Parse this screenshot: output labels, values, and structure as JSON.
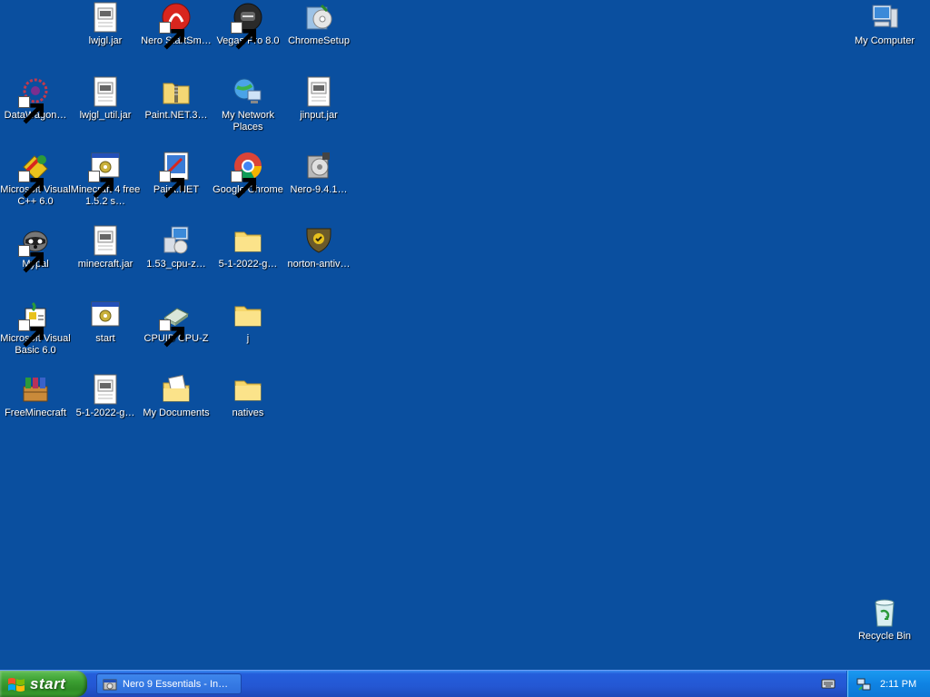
{
  "desktop": {
    "background": "#0a4f9f",
    "icons": {
      "lwjgl_jar": "lwjgl.jar",
      "nero_startsmart": "Nero StartSm…",
      "vegas_pro": "Vegas Pro 8.0",
      "chromesetup": "ChromeSetup",
      "my_computer": "My Computer",
      "datawagon": "DataWagon…",
      "lwjgl_util_jar": "lwjgl_util.jar",
      "paint_net_zip": "Paint.NET.3…",
      "my_network_places": "My Network Places",
      "jinput_jar": "jinput.jar",
      "ms_visual_cpp": "Microsoft Visual C++ 6.0",
      "minecraft4free": "Minecraft 4 free 1.5.2 s…",
      "paint_net": "Paint.NET",
      "google_chrome": "Google Chrome",
      "nero_941": "Nero-9.4.1…",
      "mypal": "Mypal",
      "minecraft_jar": "minecraft.jar",
      "cpu_z_setup": "1.53_cpu-z…",
      "folder_5_1_2022": "5-1-2022-g…",
      "norton_antivirus": "norton-antiv…",
      "ms_visual_basic": "Microsoft Visual Basic 6.0",
      "start_bat": "start",
      "cpuid_cpu_z": "CPUID CPU-Z",
      "folder_j": "j",
      "freeminecraft": "FreeMinecraft",
      "file_5_1_2022": "5-1-2022-g…",
      "my_documents": "My Documents",
      "natives": "natives",
      "recycle_bin": "Recycle Bin"
    }
  },
  "taskbar": {
    "start_label": "start",
    "task_item_label": "Nero 9 Essentials - In…",
    "clock": "2:11 PM"
  }
}
